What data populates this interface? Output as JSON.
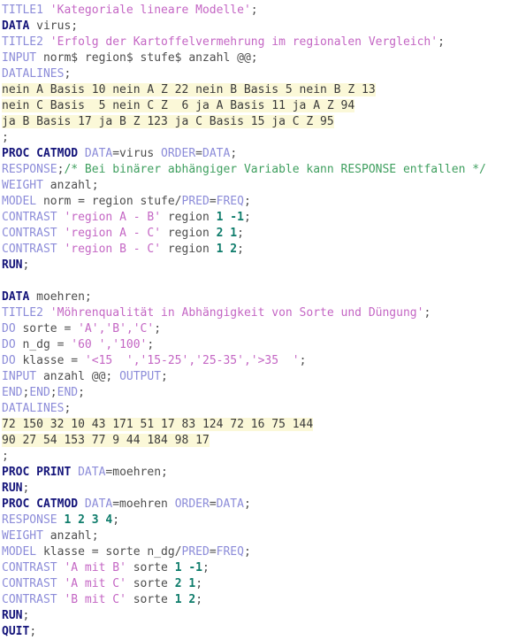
{
  "editor": {
    "language": "SAS",
    "background_color": "#ffffff",
    "highlight_color": "#fbf8d8",
    "colors": {
      "statement": "#8c8cd9",
      "proc_bold": "#14147a",
      "string": "#c466c4",
      "plain": "#4d4d4d",
      "number": "#0e7c6b",
      "comment": "#3f9f5f"
    }
  },
  "code": {
    "lines": [
      {
        "id": 1,
        "highlight": false,
        "tokens": [
          {
            "t": "TITLE1",
            "c": "stmt"
          },
          {
            "t": " ",
            "c": "plain"
          },
          {
            "t": "'Kategoriale lineare Modelle'",
            "c": "str"
          },
          {
            "t": ";",
            "c": "plain"
          }
        ]
      },
      {
        "id": 2,
        "highlight": false,
        "tokens": [
          {
            "t": "DATA",
            "c": "proc"
          },
          {
            "t": " virus;",
            "c": "plain"
          }
        ]
      },
      {
        "id": 3,
        "highlight": false,
        "tokens": [
          {
            "t": "TITLE2",
            "c": "stmt"
          },
          {
            "t": " ",
            "c": "plain"
          },
          {
            "t": "'Erfolg der Kartoffelvermehrung im regionalen Vergleich'",
            "c": "str"
          },
          {
            "t": ";",
            "c": "plain"
          }
        ]
      },
      {
        "id": 4,
        "highlight": false,
        "tokens": [
          {
            "t": "INPUT",
            "c": "stmt"
          },
          {
            "t": " norm$ region$ stufe$ anzahl @@;",
            "c": "plain"
          }
        ]
      },
      {
        "id": 5,
        "highlight": false,
        "tokens": [
          {
            "t": "DATALINES",
            "c": "stmt"
          },
          {
            "t": ";",
            "c": "plain"
          }
        ]
      },
      {
        "id": 6,
        "highlight": true,
        "tokens": [
          {
            "t": "nein A Basis 10 nein A Z 22 nein B Basis 5 nein B Z 13",
            "c": "data"
          }
        ]
      },
      {
        "id": 7,
        "highlight": true,
        "tokens": [
          {
            "t": "nein C Basis  5 nein C Z  6 ja A Basis 11 ja A Z 94",
            "c": "data"
          }
        ]
      },
      {
        "id": 8,
        "highlight": true,
        "tokens": [
          {
            "t": "ja B Basis 17 ja B Z 123 ja C Basis 15 ja C Z 95",
            "c": "data"
          }
        ]
      },
      {
        "id": 9,
        "highlight": false,
        "tokens": [
          {
            "t": ";",
            "c": "plain"
          }
        ]
      },
      {
        "id": 10,
        "highlight": false,
        "tokens": [
          {
            "t": "PROC CATMOD",
            "c": "proc"
          },
          {
            "t": " ",
            "c": "plain"
          },
          {
            "t": "DATA",
            "c": "opt"
          },
          {
            "t": "=virus ",
            "c": "plain"
          },
          {
            "t": "ORDER",
            "c": "opt"
          },
          {
            "t": "=",
            "c": "plain"
          },
          {
            "t": "DATA",
            "c": "opt"
          },
          {
            "t": ";",
            "c": "plain"
          }
        ]
      },
      {
        "id": 11,
        "highlight": false,
        "tokens": [
          {
            "t": "RESPONSE",
            "c": "stmt"
          },
          {
            "t": ";",
            "c": "plain"
          },
          {
            "t": "/* Bei binärer abhängiger Variable kann RESPONSE entfallen */",
            "c": "comment"
          }
        ]
      },
      {
        "id": 12,
        "highlight": false,
        "tokens": [
          {
            "t": "WEIGHT",
            "c": "stmt"
          },
          {
            "t": " anzahl;",
            "c": "plain"
          }
        ]
      },
      {
        "id": 13,
        "highlight": false,
        "tokens": [
          {
            "t": "MODEL",
            "c": "stmt"
          },
          {
            "t": " norm = region stufe/",
            "c": "plain"
          },
          {
            "t": "PRED",
            "c": "opt"
          },
          {
            "t": "=",
            "c": "plain"
          },
          {
            "t": "FREQ",
            "c": "opt"
          },
          {
            "t": ";",
            "c": "plain"
          }
        ]
      },
      {
        "id": 14,
        "highlight": false,
        "tokens": [
          {
            "t": "CONTRAST",
            "c": "stmt"
          },
          {
            "t": " ",
            "c": "plain"
          },
          {
            "t": "'region A - B'",
            "c": "str"
          },
          {
            "t": " region ",
            "c": "plain"
          },
          {
            "t": "1 -1",
            "c": "num"
          },
          {
            "t": ";",
            "c": "plain"
          }
        ]
      },
      {
        "id": 15,
        "highlight": false,
        "tokens": [
          {
            "t": "CONTRAST",
            "c": "stmt"
          },
          {
            "t": " ",
            "c": "plain"
          },
          {
            "t": "'region A - C'",
            "c": "str"
          },
          {
            "t": " region ",
            "c": "plain"
          },
          {
            "t": "2 1",
            "c": "num"
          },
          {
            "t": ";",
            "c": "plain"
          }
        ]
      },
      {
        "id": 16,
        "highlight": false,
        "tokens": [
          {
            "t": "CONTRAST",
            "c": "stmt"
          },
          {
            "t": " ",
            "c": "plain"
          },
          {
            "t": "'region B - C'",
            "c": "str"
          },
          {
            "t": " region ",
            "c": "plain"
          },
          {
            "t": "1 2",
            "c": "num"
          },
          {
            "t": ";",
            "c": "plain"
          }
        ]
      },
      {
        "id": 17,
        "highlight": false,
        "tokens": [
          {
            "t": "RUN",
            "c": "proc"
          },
          {
            "t": ";",
            "c": "plain"
          }
        ]
      },
      {
        "id": 18,
        "highlight": false,
        "tokens": []
      },
      {
        "id": 19,
        "highlight": false,
        "tokens": [
          {
            "t": "DATA",
            "c": "proc"
          },
          {
            "t": " moehren;",
            "c": "plain"
          }
        ]
      },
      {
        "id": 20,
        "highlight": false,
        "tokens": [
          {
            "t": "TITLE2",
            "c": "stmt"
          },
          {
            "t": " ",
            "c": "plain"
          },
          {
            "t": "'Möhrenqualität in Abhängigkeit von Sorte und Düngung'",
            "c": "str"
          },
          {
            "t": ";",
            "c": "plain"
          }
        ]
      },
      {
        "id": 21,
        "highlight": false,
        "tokens": [
          {
            "t": "DO",
            "c": "stmt"
          },
          {
            "t": " sorte = ",
            "c": "plain"
          },
          {
            "t": "'A','B','C'",
            "c": "str"
          },
          {
            "t": ";",
            "c": "plain"
          }
        ]
      },
      {
        "id": 22,
        "highlight": false,
        "tokens": [
          {
            "t": "DO",
            "c": "stmt"
          },
          {
            "t": " n_dg = ",
            "c": "plain"
          },
          {
            "t": "'60 ','100'",
            "c": "str"
          },
          {
            "t": ";",
            "c": "plain"
          }
        ]
      },
      {
        "id": 23,
        "highlight": false,
        "tokens": [
          {
            "t": "DO",
            "c": "stmt"
          },
          {
            "t": " klasse = ",
            "c": "plain"
          },
          {
            "t": "'<15  ','15-25','25-35','>35  '",
            "c": "str"
          },
          {
            "t": ";",
            "c": "plain"
          }
        ]
      },
      {
        "id": 24,
        "highlight": false,
        "tokens": [
          {
            "t": "INPUT",
            "c": "stmt"
          },
          {
            "t": " anzahl @@; ",
            "c": "plain"
          },
          {
            "t": "OUTPUT",
            "c": "stmt"
          },
          {
            "t": ";",
            "c": "plain"
          }
        ]
      },
      {
        "id": 25,
        "highlight": false,
        "tokens": [
          {
            "t": "END",
            "c": "stmt"
          },
          {
            "t": ";",
            "c": "plain"
          },
          {
            "t": "END",
            "c": "stmt"
          },
          {
            "t": ";",
            "c": "plain"
          },
          {
            "t": "END",
            "c": "stmt"
          },
          {
            "t": ";",
            "c": "plain"
          }
        ]
      },
      {
        "id": 26,
        "highlight": false,
        "tokens": [
          {
            "t": "DATALINES",
            "c": "stmt"
          },
          {
            "t": ";",
            "c": "plain"
          }
        ]
      },
      {
        "id": 27,
        "highlight": true,
        "tokens": [
          {
            "t": "72 150 32 10 43 171 51 17 83 124 72 16 75 144",
            "c": "data"
          }
        ]
      },
      {
        "id": 28,
        "highlight": true,
        "tokens": [
          {
            "t": "90 27 54 153 77 9 44 184 98 17",
            "c": "data"
          }
        ]
      },
      {
        "id": 29,
        "highlight": false,
        "tokens": [
          {
            "t": ";",
            "c": "plain"
          }
        ]
      },
      {
        "id": 30,
        "highlight": false,
        "tokens": [
          {
            "t": "PROC PRINT",
            "c": "proc"
          },
          {
            "t": " ",
            "c": "plain"
          },
          {
            "t": "DATA",
            "c": "opt"
          },
          {
            "t": "=moehren;",
            "c": "plain"
          }
        ]
      },
      {
        "id": 31,
        "highlight": false,
        "tokens": [
          {
            "t": "RUN",
            "c": "proc"
          },
          {
            "t": ";",
            "c": "plain"
          }
        ]
      },
      {
        "id": 32,
        "highlight": false,
        "tokens": [
          {
            "t": "PROC CATMOD",
            "c": "proc"
          },
          {
            "t": " ",
            "c": "plain"
          },
          {
            "t": "DATA",
            "c": "opt"
          },
          {
            "t": "=moehren ",
            "c": "plain"
          },
          {
            "t": "ORDER",
            "c": "opt"
          },
          {
            "t": "=",
            "c": "plain"
          },
          {
            "t": "DATA",
            "c": "opt"
          },
          {
            "t": ";",
            "c": "plain"
          }
        ]
      },
      {
        "id": 33,
        "highlight": false,
        "tokens": [
          {
            "t": "RESPONSE",
            "c": "stmt"
          },
          {
            "t": " ",
            "c": "plain"
          },
          {
            "t": "1 2 3 4",
            "c": "num"
          },
          {
            "t": ";",
            "c": "plain"
          }
        ]
      },
      {
        "id": 34,
        "highlight": false,
        "tokens": [
          {
            "t": "WEIGHT",
            "c": "stmt"
          },
          {
            "t": " anzahl;",
            "c": "plain"
          }
        ]
      },
      {
        "id": 35,
        "highlight": false,
        "tokens": [
          {
            "t": "MODEL",
            "c": "stmt"
          },
          {
            "t": " klasse = sorte n_dg/",
            "c": "plain"
          },
          {
            "t": "PRED",
            "c": "opt"
          },
          {
            "t": "=",
            "c": "plain"
          },
          {
            "t": "FREQ",
            "c": "opt"
          },
          {
            "t": ";",
            "c": "plain"
          }
        ]
      },
      {
        "id": 36,
        "highlight": false,
        "tokens": [
          {
            "t": "CONTRAST",
            "c": "stmt"
          },
          {
            "t": " ",
            "c": "plain"
          },
          {
            "t": "'A mit B'",
            "c": "str"
          },
          {
            "t": " sorte ",
            "c": "plain"
          },
          {
            "t": "1 -1",
            "c": "num"
          },
          {
            "t": ";",
            "c": "plain"
          }
        ]
      },
      {
        "id": 37,
        "highlight": false,
        "tokens": [
          {
            "t": "CONTRAST",
            "c": "stmt"
          },
          {
            "t": " ",
            "c": "plain"
          },
          {
            "t": "'A mit C'",
            "c": "str"
          },
          {
            "t": " sorte ",
            "c": "plain"
          },
          {
            "t": "2 1",
            "c": "num"
          },
          {
            "t": ";",
            "c": "plain"
          }
        ]
      },
      {
        "id": 38,
        "highlight": false,
        "tokens": [
          {
            "t": "CONTRAST",
            "c": "stmt"
          },
          {
            "t": " ",
            "c": "plain"
          },
          {
            "t": "'B mit C'",
            "c": "str"
          },
          {
            "t": " sorte ",
            "c": "plain"
          },
          {
            "t": "1 2",
            "c": "num"
          },
          {
            "t": ";",
            "c": "plain"
          }
        ]
      },
      {
        "id": 39,
        "highlight": false,
        "tokens": [
          {
            "t": "RUN",
            "c": "proc"
          },
          {
            "t": ";",
            "c": "plain"
          }
        ]
      },
      {
        "id": 40,
        "highlight": false,
        "tokens": [
          {
            "t": "QUIT",
            "c": "proc"
          },
          {
            "t": ";",
            "c": "plain"
          }
        ]
      }
    ]
  }
}
